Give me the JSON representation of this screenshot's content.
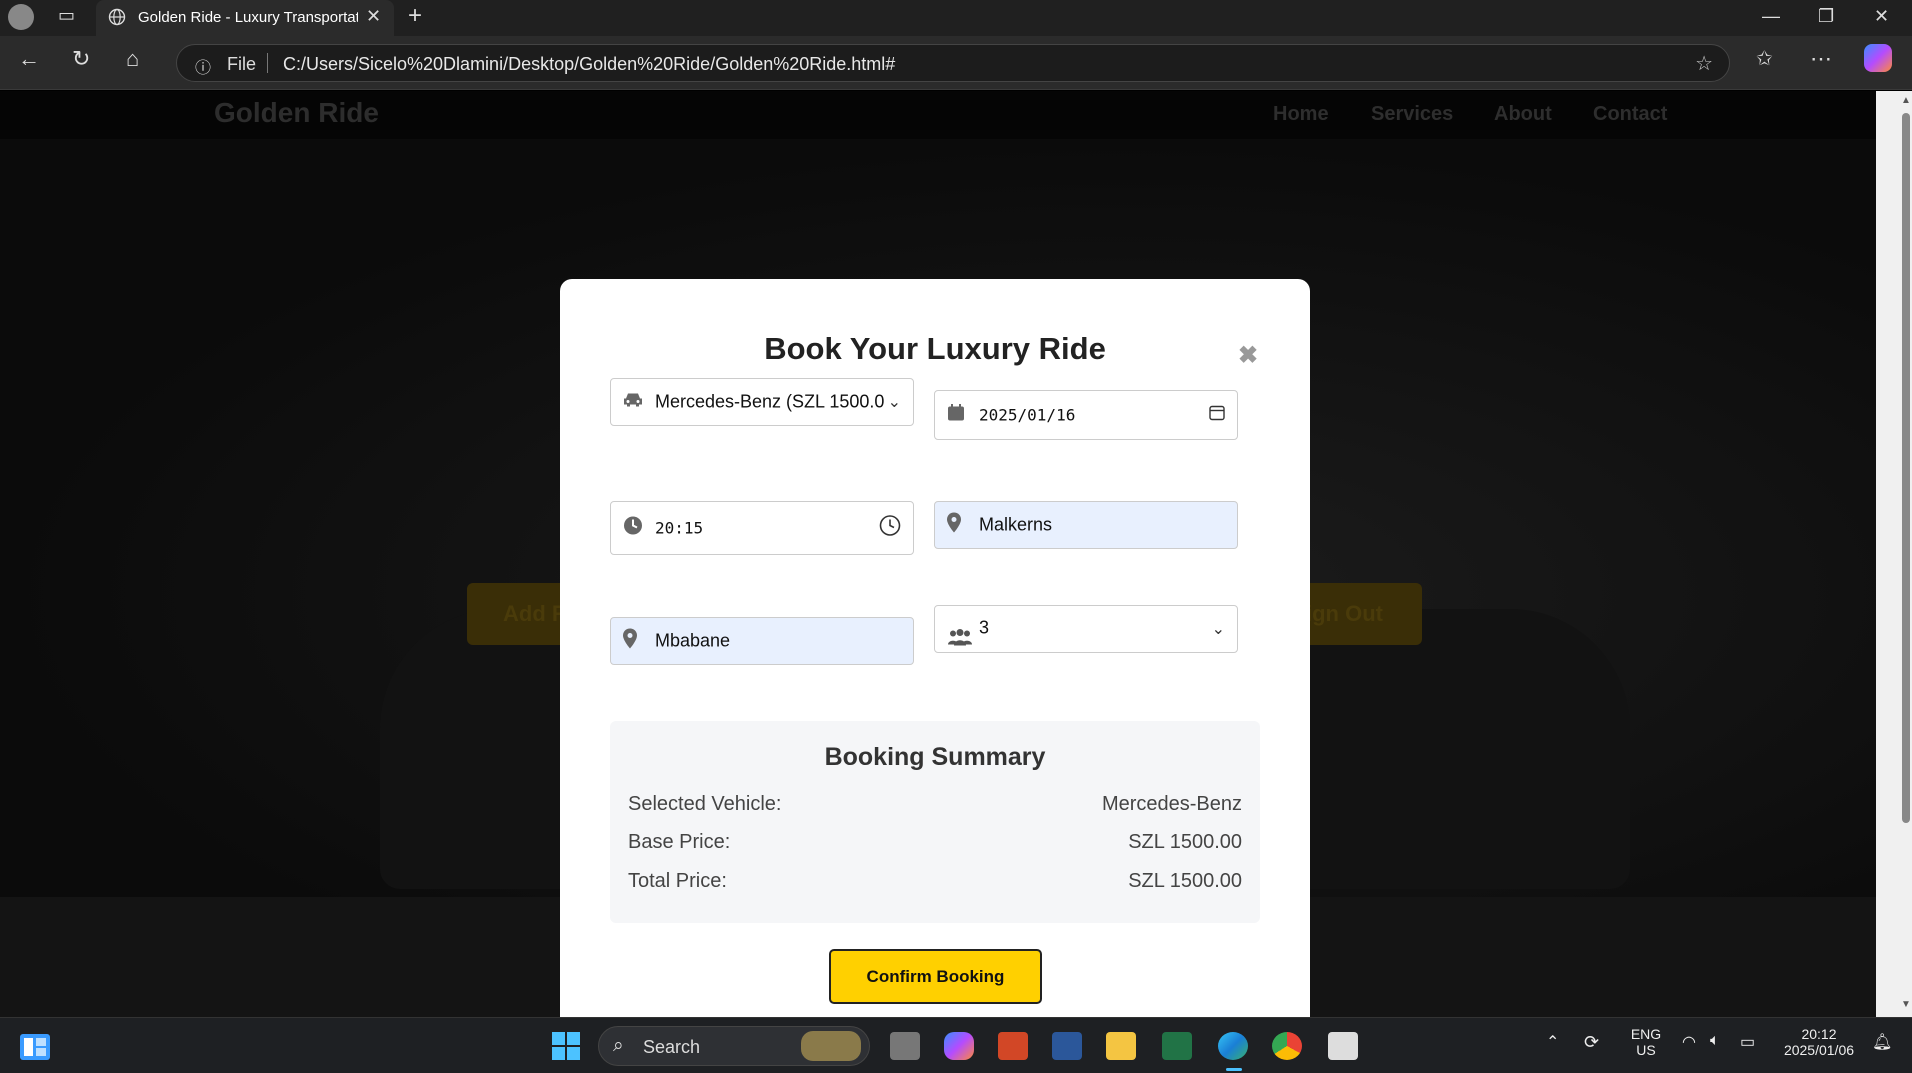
{
  "browser": {
    "tab_title": "Golden Ride - Luxury Transportati",
    "address_prefix": "File",
    "url": "C:/Users/Sicelo%20Dlamini/Desktop/Golden%20Ride/Golden%20Ride.html#"
  },
  "site": {
    "logo": "Golden Ride",
    "nav": [
      "Home",
      "Services",
      "About",
      "Contact"
    ],
    "hero_buttons": [
      "Add R",
      "ign Out"
    ]
  },
  "modal": {
    "title": "Book Your Luxury Ride",
    "close": "✖",
    "vehicle": "Mercedes-Benz (SZL 1500.0",
    "date": "2025/01/16",
    "time": "20:15",
    "pickup": "Malkerns",
    "dropoff": "Mbabane",
    "passengers": "3",
    "summary": {
      "title": "Booking Summary",
      "rows": [
        {
          "label": "Selected Vehicle:",
          "value": "Mercedes-Benz"
        },
        {
          "label": "Base Price:",
          "value": "SZL 1500.00"
        },
        {
          "label": "Total Price:",
          "value": "SZL 1500.00"
        }
      ]
    },
    "confirm_label": "Confirm Booking"
  },
  "taskbar": {
    "search_label": "Search",
    "lang_top": "ENG",
    "lang_bottom": "US",
    "time": "20:12",
    "date": "2025/01/06"
  },
  "colors": {
    "accent": "#ffd000",
    "input_highlight": "#e8f0fe"
  }
}
